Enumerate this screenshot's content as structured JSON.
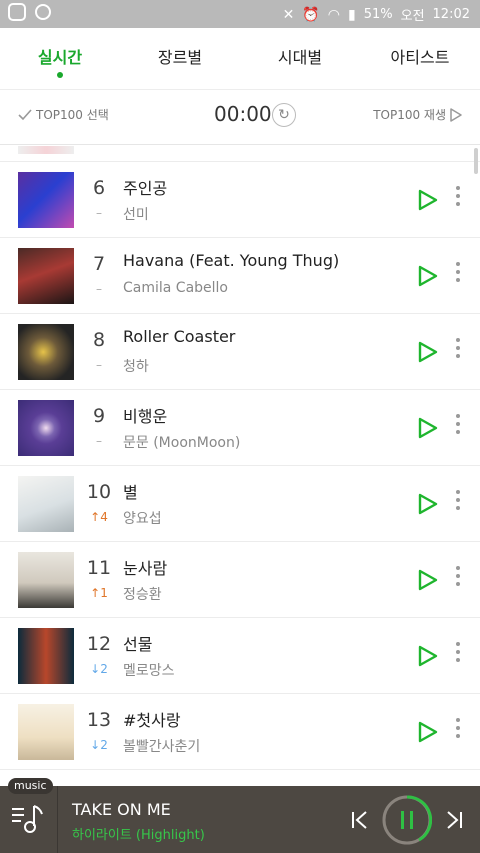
{
  "status": {
    "battery": "51%",
    "ampm": "오전",
    "time": "12:02"
  },
  "tabs": [
    {
      "label": "실시간",
      "active": true
    },
    {
      "label": "장르별"
    },
    {
      "label": "시대별"
    },
    {
      "label": "아티스트"
    }
  ],
  "controls": {
    "select_label": "TOP100 선택",
    "timer": "00:00",
    "play_label": "TOP100 재생"
  },
  "songs": [
    {
      "rank": "6",
      "change": "–",
      "dir": "same",
      "title": "주인공",
      "artist": "선미",
      "cover": "cover-1"
    },
    {
      "rank": "7",
      "change": "–",
      "dir": "same",
      "title": "Havana (Feat. Young Thug)",
      "artist": "Camila Cabello",
      "cover": "cover-2"
    },
    {
      "rank": "8",
      "change": "–",
      "dir": "same",
      "title": "Roller Coaster",
      "artist": "청하",
      "cover": "cover-3"
    },
    {
      "rank": "9",
      "change": "–",
      "dir": "same",
      "title": "비행운",
      "artist": "문문 (MoonMoon)",
      "cover": "cover-4"
    },
    {
      "rank": "10",
      "change": "↑4",
      "dir": "up",
      "title": "별",
      "artist": "양요섭",
      "cover": "cover-5"
    },
    {
      "rank": "11",
      "change": "↑1",
      "dir": "up",
      "title": "눈사람",
      "artist": "정승환",
      "cover": "cover-6"
    },
    {
      "rank": "12",
      "change": "↓2",
      "dir": "down",
      "title": "선물",
      "artist": "멜로망스",
      "cover": "cover-7"
    },
    {
      "rank": "13",
      "change": "↓2",
      "dir": "down",
      "title": "#첫사랑",
      "artist": "볼빨간사춘기",
      "cover": "cover-8"
    }
  ],
  "player": {
    "badge": "music",
    "title": "TAKE ON ME",
    "artist": "하이라이트 (Highlight)"
  },
  "colors": {
    "accent": "#1aa82d",
    "player_bg": "#4d4842",
    "up": "#e0762a",
    "down": "#62a8e8"
  }
}
